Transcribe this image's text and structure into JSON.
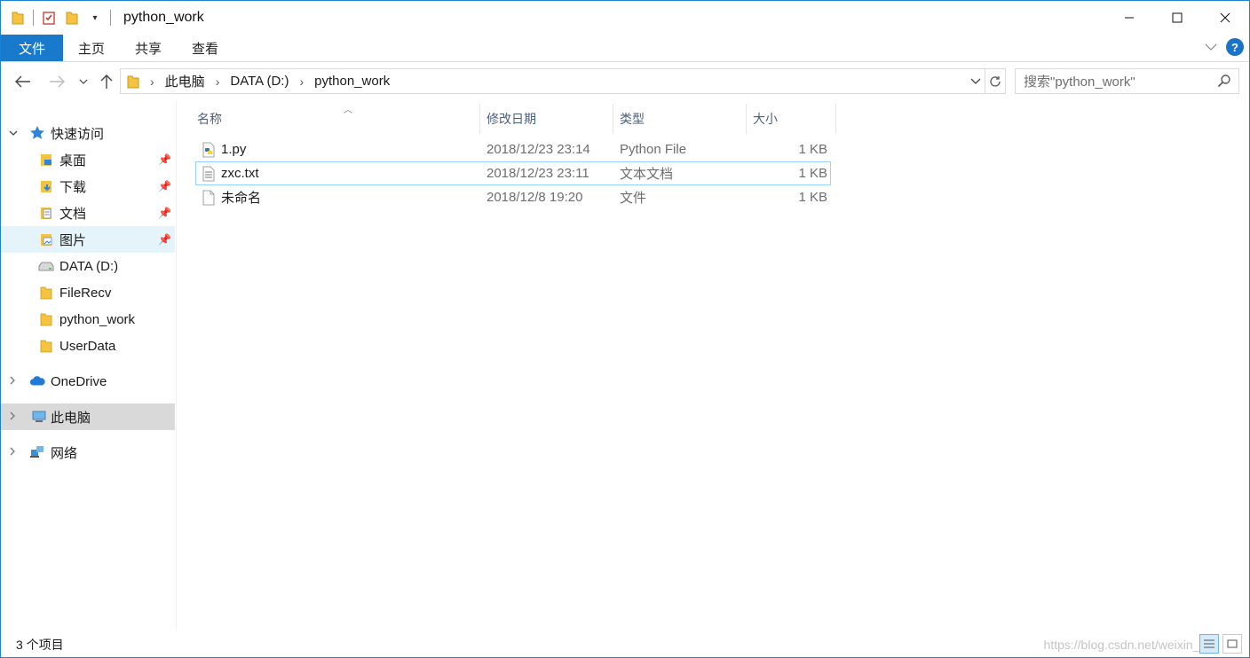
{
  "window": {
    "title": "python_work"
  },
  "ribbon": {
    "tabs": [
      "文件",
      "主页",
      "共享",
      "查看"
    ]
  },
  "address": {
    "crumbs": [
      "此电脑",
      "DATA (D:)",
      "python_work"
    ]
  },
  "search": {
    "placeholder": "搜索\"python_work\""
  },
  "nav": {
    "quick_access": "快速访问",
    "items": [
      "桌面",
      "下载",
      "文档",
      "图片",
      "DATA (D:)",
      "FileRecv",
      "python_work",
      "UserData"
    ],
    "onedrive": "OneDrive",
    "this_pc": "此电脑",
    "network": "网络"
  },
  "columns": {
    "name": "名称",
    "date": "修改日期",
    "type": "类型",
    "size": "大小"
  },
  "files": [
    {
      "name": "1.py",
      "date": "2018/12/23 23:14",
      "type": "Python File",
      "size": "1 KB",
      "icon": "python-file-icon"
    },
    {
      "name": "zxc.txt",
      "date": "2018/12/23 23:11",
      "type": "文本文档",
      "size": "1 KB",
      "icon": "text-file-icon"
    },
    {
      "name": "未命名",
      "date": "2018/12/8 19:20",
      "type": "文件",
      "size": "1 KB",
      "icon": "blank-file-icon"
    }
  ],
  "status": {
    "count": "3 个项目"
  },
  "watermark": "https://blog.csdn.net/weixin_43",
  "colors": {
    "accent": "#1979ca",
    "folder": "#f5c342",
    "hover": "#e5f3fb",
    "selected": "#d9d9d9"
  }
}
